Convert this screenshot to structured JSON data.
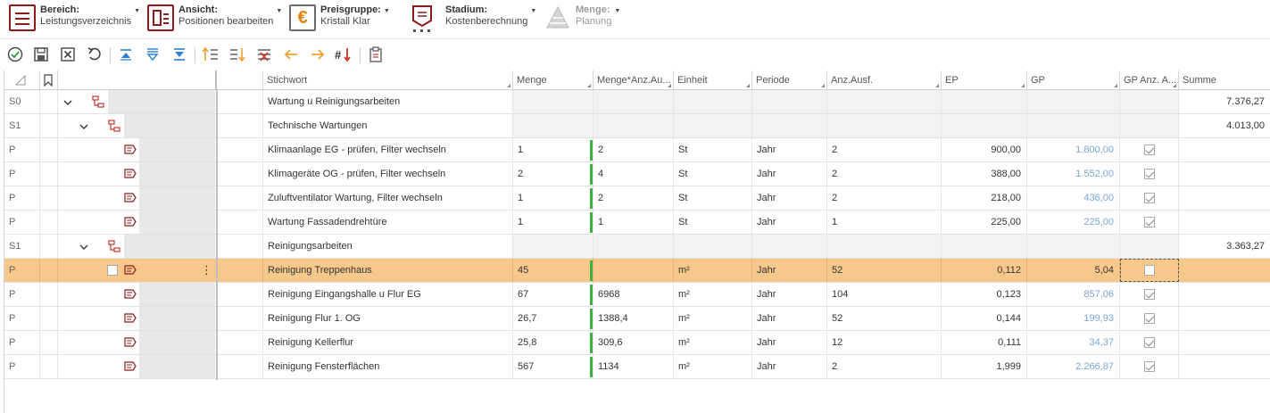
{
  "ribbon": {
    "bereich": {
      "title": "Bereich:",
      "value": "Leistungsverzeichnis"
    },
    "ansicht": {
      "title": "Ansicht:",
      "value": "Positionen bearbeiten"
    },
    "preisgruppe": {
      "title": "Preisgruppe:",
      "value": "Kristall Klar"
    },
    "stadium": {
      "title": "Stadium:",
      "value": "Kostenberechnung"
    },
    "menge": {
      "title": "Menge:",
      "value": "Planung"
    }
  },
  "toolbar": {
    "icons": [
      "check-icon",
      "save-icon",
      "close-icon",
      "undo-icon",
      "collapse-up-icon",
      "expand-all-icon",
      "collapse-down-icon",
      "sort-asc-icon",
      "sort-desc-icon",
      "delete-sort-icon",
      "arrow-left-icon",
      "arrow-right-icon",
      "number-sort-icon",
      "clipboard-icon"
    ]
  },
  "columns": {
    "stichwort": "Stichwort",
    "menge": "Menge",
    "menge_anz": "Menge*Anz.Au...",
    "einheit": "Einheit",
    "periode": "Periode",
    "anz_ausf": "Anz.Ausf.",
    "ep": "EP",
    "gp": "GP",
    "gp_anz": "GP Anz. A...",
    "summe": "Summe"
  },
  "rows": [
    {
      "type": "S0",
      "stichwort": "Wartung u Reinigungsarbeiten",
      "summe": "7.376,27"
    },
    {
      "type": "S1",
      "stichwort": "Technische Wartungen",
      "summe": "4.013,00"
    },
    {
      "type": "P",
      "stichwort": "Klimaanlage EG - prüfen, Filter wechseln",
      "menge": "1",
      "menge_anz": "2",
      "einheit": "St",
      "periode": "Jahr",
      "anz_ausf": "2",
      "ep": "900,00",
      "gp": "1.800,00",
      "gp_anz": true
    },
    {
      "type": "P",
      "stichwort": "Klimageräte OG - prüfen, Filter wechseln",
      "menge": "2",
      "menge_anz": "4",
      "einheit": "St",
      "periode": "Jahr",
      "anz_ausf": "2",
      "ep": "388,00",
      "gp": "1.552,00",
      "gp_anz": true
    },
    {
      "type": "P",
      "stichwort": "Zuluftventilator Wartung, Filter wechseln",
      "menge": "1",
      "menge_anz": "2",
      "einheit": "St",
      "periode": "Jahr",
      "anz_ausf": "2",
      "ep": "218,00",
      "gp": "436,00",
      "gp_anz": true
    },
    {
      "type": "P",
      "stichwort": "Wartung Fassadendrehtüre",
      "menge": "1",
      "menge_anz": "1",
      "einheit": "St",
      "periode": "Jahr",
      "anz_ausf": "1",
      "ep": "225,00",
      "gp": "225,00",
      "gp_anz": true
    },
    {
      "type": "S1",
      "stichwort": "Reinigungsarbeiten",
      "summe": "3.363,27"
    },
    {
      "type": "P",
      "stichwort": "Reinigung Treppenhaus",
      "menge": "45",
      "menge_anz": "",
      "einheit": "m²",
      "periode": "Jahr",
      "anz_ausf": "52",
      "ep": "0,112",
      "gp": "5,04",
      "gp_anz": false,
      "selected": true
    },
    {
      "type": "P",
      "stichwort": "Reinigung Eingangshalle u Flur EG",
      "menge": "67",
      "menge_anz": "6968",
      "einheit": "m²",
      "periode": "Jahr",
      "anz_ausf": "104",
      "ep": "0,123",
      "gp": "857,06",
      "gp_anz": true
    },
    {
      "type": "P",
      "stichwort": "Reinigung Flur 1. OG",
      "menge": "26,7",
      "menge_anz": "1388,4",
      "einheit": "m²",
      "periode": "Jahr",
      "anz_ausf": "52",
      "ep": "0,144",
      "gp": "199,93",
      "gp_anz": true
    },
    {
      "type": "P",
      "stichwort": "Reinigung Kellerflur",
      "menge": "25,8",
      "menge_anz": "309,6",
      "einheit": "m²",
      "periode": "Jahr",
      "anz_ausf": "12",
      "ep": "0,111",
      "gp": "34,37",
      "gp_anz": true
    },
    {
      "type": "P",
      "stichwort": "Reinigung Fensterflächen",
      "menge": "567",
      "menge_anz": "1134",
      "einheit": "m²",
      "periode": "Jahr",
      "anz_ausf": "2",
      "ep": "1,999",
      "gp": "2.266,87",
      "gp_anz": true
    }
  ],
  "colors": {
    "accent": "#8a1c1c",
    "selection": "#f6c88c",
    "gp_text": "#7ba6d6",
    "bar": "#3cb043",
    "toolbar_blue": "#2b7fd4",
    "toolbar_orange": "#f0a030"
  }
}
